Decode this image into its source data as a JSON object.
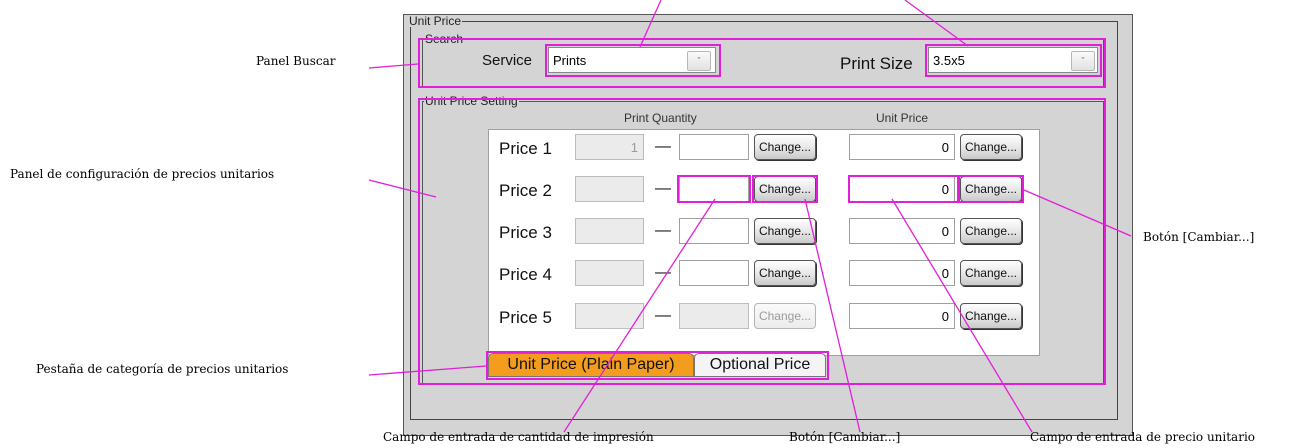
{
  "window": {
    "group_title": "Unit Price",
    "search_title": "Search",
    "setting_title": "Unit Price Setting"
  },
  "search": {
    "service_label": "Service",
    "service_value": "Prints",
    "print_size_label": "Print Size",
    "print_size_value": "3.5x5",
    "dropdown_glyph": "ˇ"
  },
  "setting": {
    "col_quantity": "Print Quantity",
    "col_unit_price": "Unit Price",
    "dash": "—",
    "rows": [
      {
        "label": "Price 1",
        "qty_from": "1",
        "qty_to": "",
        "qty_button": "Change...",
        "qty_button_enabled": true,
        "price": "0",
        "price_button": "Change..."
      },
      {
        "label": "Price 2",
        "qty_from": "",
        "qty_to": "",
        "qty_button": "Change...",
        "qty_button_enabled": true,
        "price": "0",
        "price_button": "Change..."
      },
      {
        "label": "Price 3",
        "qty_from": "",
        "qty_to": "",
        "qty_button": "Change...",
        "qty_button_enabled": true,
        "price": "0",
        "price_button": "Change..."
      },
      {
        "label": "Price 4",
        "qty_from": "",
        "qty_to": "",
        "qty_button": "Change...",
        "qty_button_enabled": true,
        "price": "0",
        "price_button": "Change..."
      },
      {
        "label": "Price 5",
        "qty_from": "",
        "qty_to": "",
        "qty_button": "Change...",
        "qty_button_enabled": false,
        "price": "0",
        "price_button": "Change..."
      }
    ],
    "tabs": [
      {
        "label": "Unit Price (Plain Paper)",
        "active": true
      },
      {
        "label": "Optional Price",
        "active": false
      }
    ]
  },
  "annotations": {
    "panel_search": "Panel Buscar",
    "panel_config": "Panel de configuración de precios unitarios",
    "change_button_right": "Botón [Cambiar...]",
    "tab_category": "Pestaña de categoría de precios unitarios",
    "qty_field": "Campo de entrada de cantidad de impresión",
    "change_button_bottom": "Botón [Cambiar...]",
    "price_field": "Campo de entrada de precio unitario"
  },
  "colors": {
    "highlight": "#e020d8",
    "active_tab": "#f39c1e",
    "window_bg": "#d4d4d4"
  }
}
